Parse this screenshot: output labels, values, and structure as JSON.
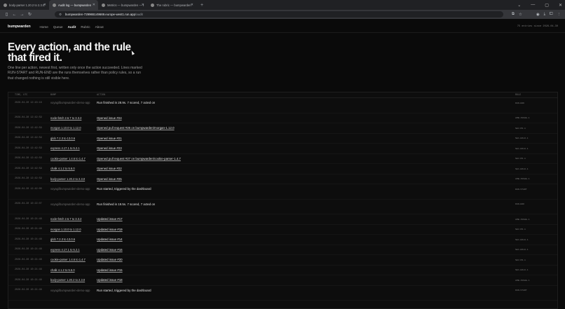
{
  "browser": {
    "tabs": [
      {
        "title": "body-parser 1.20.2 to 2.3.0: ca"
      },
      {
        "title": "Audit log — bumpwarden"
      },
      {
        "title": "Metrics — bumpwarden — Cloud"
      },
      {
        "title": "The rubric — bumpwarden"
      }
    ],
    "url_host": "bumpwarden-729965149669.europe-west1.run.app",
    "url_path": "/audit"
  },
  "nav": {
    "brand": "bumpwarden",
    "links": [
      "Home",
      "Queue",
      "Audit",
      "Rubric",
      "About"
    ],
    "meta": "75 entries since 2026-04-30"
  },
  "hero": {
    "title_line1": "Every action, and the rule",
    "title_line2": "that fired it.",
    "lede": "One line per action, newest first, written only once the action succeeded. Lines marked RUN-START and RUN-END are the runs themselves rather than policy rules, so a run that changed nothing is still visible here."
  },
  "table": {
    "headers": [
      "TIME, UTC",
      "BUMP",
      "ACTION",
      "RULE"
    ],
    "rows": [
      {
        "time": "2026-04-30 12:43:16",
        "bump": "voyagi/bumpwarden-demo-app",
        "action": "Run finished in 28.9s. 7 scored, 7 acted on",
        "rule": "RUN-END"
      },
      {
        "time": "2026-04-30 12:42:59",
        "bump": "node-fetch 2.6.7 to 3.3.2",
        "action": "Opened issue #24",
        "rule": "AMB-ISSUE-1"
      },
      {
        "time": "2026-04-30 12:42:59",
        "bump": "morgan 1.10.0 to 1.12.0",
        "action": "Opened pull request #26 on bumpwarden/morgan-1.12.0",
        "rule": "SEV-PR-1"
      },
      {
        "time": "2026-04-30 12:42:59",
        "bump": "glob 7.2.3 to 13.0.6",
        "action": "Opened issue #21",
        "rule": "SEC-HOLD-1"
      },
      {
        "time": "2026-04-30 12:42:59",
        "bump": "express 4.17.1 to 5.2.1",
        "action": "Opened issue #23",
        "rule": "SEC-HOLD-1"
      },
      {
        "time": "2026-04-30 12:42:59",
        "bump": "cookie-parser 1.4.6 to 1.4.7",
        "action": "Opened pull request #27 on bumpwarden/cookie-parser-1.4.7",
        "rule": "SEV-PR-1"
      },
      {
        "time": "2026-04-30 12:42:59",
        "bump": "chalk 4.1.2 to 5.6.0",
        "action": "Opened issue #22",
        "rule": "SEC-HOLD-1"
      },
      {
        "time": "2026-04-30 12:42:59",
        "bump": "body-parser 1.20.2 to 2.3.0",
        "action": "Opened issue #25",
        "rule": "AMB-ISSUE-1"
      },
      {
        "time": "2026-04-30 12:42:00",
        "bump": "voyagi/bumpwarden-demo-app",
        "action": "Run started, triggered by the dashboard",
        "rule": "RUN-START"
      },
      {
        "time": "2026-04-30 10:22:07",
        "bump": "voyagi/bumpwarden-demo-app",
        "action": "Run finished in 19.5s. 7 scored, 7 acted on",
        "rule": "RUN-END"
      },
      {
        "time": "2026-04-30 10:21:48",
        "bump": "node-fetch 2.6.7 to 3.3.2",
        "action": "Updated issue #17",
        "rule": "AMB-ISSUE-1"
      },
      {
        "time": "2026-04-30 10:21:48",
        "bump": "morgan 1.10.0 to 1.12.0",
        "action": "Updated issue #19",
        "rule": "SEV-PR-1"
      },
      {
        "time": "2026-04-30 10:21:48",
        "bump": "glob 7.2.3 to 13.0.6",
        "action": "Updated issue #14",
        "rule": "SEC-HOLD-1"
      },
      {
        "time": "2026-04-30 10:21:48",
        "bump": "express 4.17.1 to 5.2.1",
        "action": "Updated issue #16",
        "rule": "SEC-HOLD-1"
      },
      {
        "time": "2026-04-30 10:21:48",
        "bump": "cookie-parser 1.4.6 to 1.4.7",
        "action": "Updated issue #20",
        "rule": "SEV-PR-1"
      },
      {
        "time": "2026-04-30 10:21:48",
        "bump": "chalk 4.1.2 to 5.6.0",
        "action": "Updated issue #15",
        "rule": "SEC-HOLD-1"
      },
      {
        "time": "2026-04-30 10:21:48",
        "bump": "body-parser 1.20.2 to 2.3.0",
        "action": "Updated issue #18",
        "rule": "AMB-ISSUE-1"
      },
      {
        "time": "2026-04-30 10:21:48",
        "bump": "voyagi/bumpwarden-demo-app",
        "action": "Run started, triggered by the dashboard",
        "rule": "RUN-START"
      }
    ]
  }
}
